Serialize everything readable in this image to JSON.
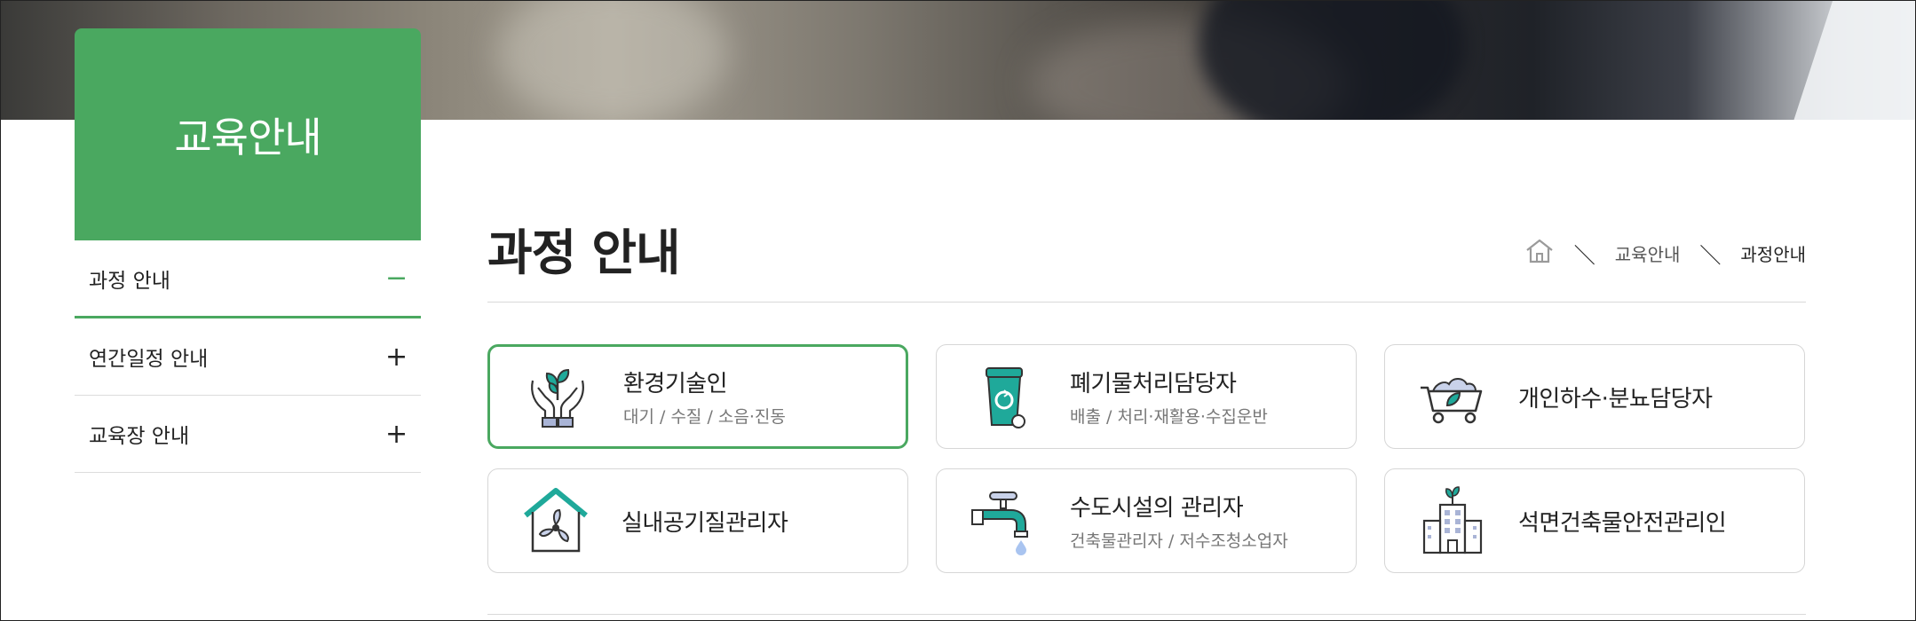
{
  "sidebar": {
    "title": "교육안내",
    "items": [
      {
        "label": "과정 안내",
        "sign": "−"
      },
      {
        "label": "연간일정 안내",
        "sign": "+"
      },
      {
        "label": "교육장 안내",
        "sign": "+"
      }
    ]
  },
  "main": {
    "title": "과정 안내",
    "breadcrumb": {
      "sep": "＼",
      "level1": "교육안내",
      "current": "과정안내"
    },
    "cards": [
      {
        "name": "환경기술인",
        "sub": "대기 / 수질 / 소음·진동",
        "icon": "hands-plant-icon"
      },
      {
        "name": "폐기물처리담당자",
        "sub": "배출 / 처리·재활용·수집운반",
        "icon": "recycle-bin-icon"
      },
      {
        "name": "개인하수·분뇨담당자",
        "sub": "",
        "icon": "cart-leaf-icon"
      },
      {
        "name": "실내공기질관리자",
        "sub": "",
        "icon": "house-fan-icon"
      },
      {
        "name": "수도시설의 관리자",
        "sub": "건축물관리자 / 저수조청소업자",
        "icon": "water-faucet-icon"
      },
      {
        "name": "석면건축물안전관리인",
        "sub": "",
        "icon": "building-plant-icon"
      }
    ]
  },
  "colors": {
    "accent": "#4aa860",
    "teal": "#1fa99a"
  }
}
